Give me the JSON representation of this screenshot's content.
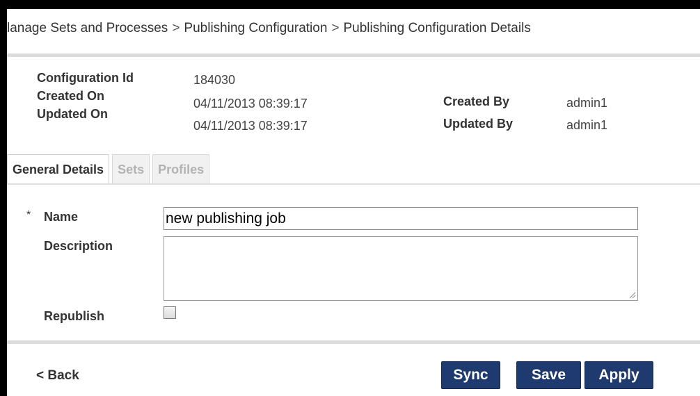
{
  "breadcrumb": {
    "items": [
      "lanage Sets and Processes",
      "Publishing Configuration",
      "Publishing Configuration Details"
    ],
    "separator": ">"
  },
  "meta": {
    "config_id_label": "Configuration Id",
    "config_id_value": "184030",
    "created_on_label": "Created On",
    "created_on_value": "04/11/2013 08:39:17",
    "updated_on_label": "Updated On",
    "updated_on_value": "04/11/2013 08:39:17",
    "created_by_label": "Created By",
    "created_by_value": "admin1",
    "updated_by_label": "Updated By",
    "updated_by_value": "admin1"
  },
  "tabs": [
    {
      "label": "General Details",
      "active": true
    },
    {
      "label": "Sets",
      "active": false
    },
    {
      "label": "Profiles",
      "active": false
    }
  ],
  "form": {
    "required_marker": "*",
    "name_label": "Name",
    "name_value": "new publishing job",
    "description_label": "Description",
    "description_value": "",
    "republish_label": "Republish",
    "republish_checked": false
  },
  "footer": {
    "back_label": "< Back",
    "sync_label": "Sync",
    "save_label": "Save",
    "apply_label": "Apply"
  },
  "colors": {
    "button_bg": "#1f3a6e",
    "inactive_tab_text": "#b3b3b3",
    "frame": "#000000"
  }
}
